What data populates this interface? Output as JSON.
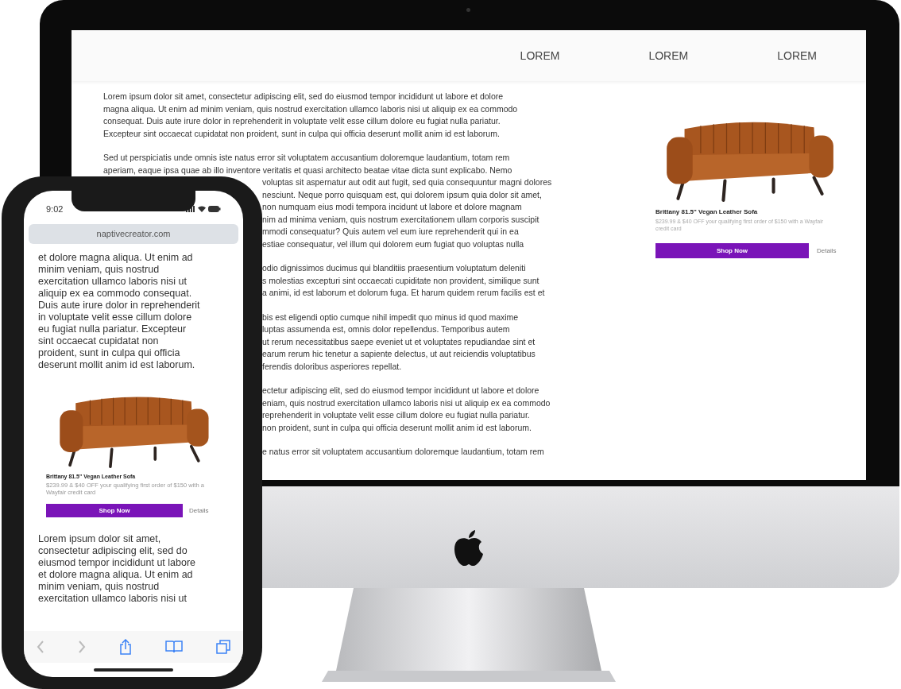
{
  "desktop": {
    "nav": {
      "items": [
        "LOREM",
        "LOREM",
        "LOREM"
      ]
    },
    "paragraphs": [
      {
        "lines": [
          {
            "kind": "full",
            "text": "Lorem ipsum dolor sit amet, consectetur adipiscing elit, sed do eiusmod tempor incididunt ut labore et dolore"
          },
          {
            "kind": "full",
            "text": "magna aliqua. Ut enim ad minim veniam, quis nostrud exercitation ullamco laboris nisi ut aliquip ex ea commodo"
          },
          {
            "kind": "full",
            "text": "consequat. Duis aute irure dolor in reprehenderit in voluptate velit esse cillum dolore eu fugiat nulla pariatur."
          },
          {
            "kind": "full",
            "text": "Excepteur sint occaecat cupidatat non proident, sunt in culpa qui officia deserunt mollit anim id est laborum."
          }
        ]
      },
      {
        "lines": [
          {
            "kind": "full",
            "text": "Sed ut perspiciatis unde omnis iste natus error sit voluptatem accusantium doloremque laudantium, totam rem"
          },
          {
            "kind": "full",
            "text": "aperiam, eaque ipsa quae ab illo inventore veritatis et quasi architecto beatae vitae dicta sunt explicabo. Nemo"
          },
          {
            "kind": "partial",
            "text": "voluptas sit aspernatur aut odit aut fugit, sed quia consequuntur magni dolores"
          },
          {
            "kind": "partial",
            "text": "nesciunt. Neque porro quisquam est, qui dolorem ipsum quia dolor sit amet,"
          },
          {
            "kind": "partial",
            "text": "non numquam eius modi tempora incidunt ut labore et dolore magnam"
          },
          {
            "kind": "partial",
            "text": "nim ad minima veniam, quis nostrum exercitationem ullam corporis suscipit"
          },
          {
            "kind": "partial",
            "text": "mmodi consequatur? Quis autem vel eum iure reprehenderit qui in ea"
          },
          {
            "kind": "partial",
            "text": "estiae consequatur, vel illum qui dolorem eum fugiat quo voluptas nulla"
          }
        ]
      },
      {
        "lines": [
          {
            "kind": "partial",
            "text": "odio dignissimos ducimus qui blanditiis praesentium voluptatum deleniti"
          },
          {
            "kind": "partial",
            "text": "s molestias excepturi sint occaecati cupiditate non provident, similique sunt"
          },
          {
            "kind": "partial",
            "text": "a animi, id est laborum et dolorum fuga. Et harum quidem rerum facilis est et"
          }
        ]
      },
      {
        "lines": [
          {
            "kind": "partial",
            "text": "bis est eligendi optio cumque nihil impedit quo minus id quod maxime"
          },
          {
            "kind": "partial",
            "text": "luptas assumenda est, omnis dolor repellendus. Temporibus autem"
          },
          {
            "kind": "partial",
            "text": "ut rerum necessitatibus saepe eveniet ut et voluptates repudiandae sint et"
          },
          {
            "kind": "partial",
            "text": "earum rerum hic tenetur a sapiente delectus, ut aut reiciendis voluptatibus"
          },
          {
            "kind": "partial",
            "text": "ferendis doloribus asperiores repellat."
          }
        ]
      },
      {
        "lines": [
          {
            "kind": "partial",
            "text": "ectetur adipiscing elit, sed do eiusmod tempor incididunt ut labore et dolore"
          },
          {
            "kind": "partial",
            "text": "eniam, quis nostrud exercitation ullamco laboris nisi ut aliquip ex ea commodo"
          },
          {
            "kind": "partial",
            "text": "reprehenderit in voluptate velit esse cillum dolore eu fugiat nulla pariatur."
          },
          {
            "kind": "partial",
            "text": "non proident, sunt in culpa qui officia deserunt mollit anim id est laborum."
          }
        ]
      },
      {
        "lines": [
          {
            "kind": "partial",
            "text": "e natus error sit voluptatem accusantium doloremque laudantium, totam rem"
          }
        ]
      }
    ],
    "product": {
      "title": "Brittany 81.5\" Vegan Leather Sofa",
      "description": "$239.99 & $40 OFF your qualifying first order of $150 with a Wayfair credit card",
      "button": "Shop Now",
      "link": "Details"
    }
  },
  "phone": {
    "time": "9:02",
    "url": "naptivecreator.com",
    "lines_top": [
      "et dolore magna aliqua. Ut enim ad",
      "minim veniam, quis nostrud",
      "exercitation ullamco laboris nisi ut",
      "aliquip ex ea commodo consequat.",
      "Duis aute irure dolor in reprehenderit",
      "in voluptate velit esse cillum dolore",
      "eu fugiat nulla pariatur. Excepteur",
      "sint occaecat cupidatat non",
      "proident, sunt in culpa qui officia",
      "deserunt mollit anim id est laborum."
    ],
    "product": {
      "title": "Brittany 81.5\" Vegan Leather Sofa",
      "description": "$239.99 & $40 OFF your qualifying first order of $150 with a Wayfair credit card",
      "button": "Shop Now",
      "link": "Details"
    },
    "lines_bottom": [
      "Lorem ipsum dolor sit amet,",
      "consectetur adipiscing elit, sed do",
      "eiusmod tempor incididunt ut labore",
      "et dolore magna aliqua. Ut enim ad",
      "minim veniam, quis nostrud",
      "exercitation ullamco laboris nisi ut"
    ]
  }
}
